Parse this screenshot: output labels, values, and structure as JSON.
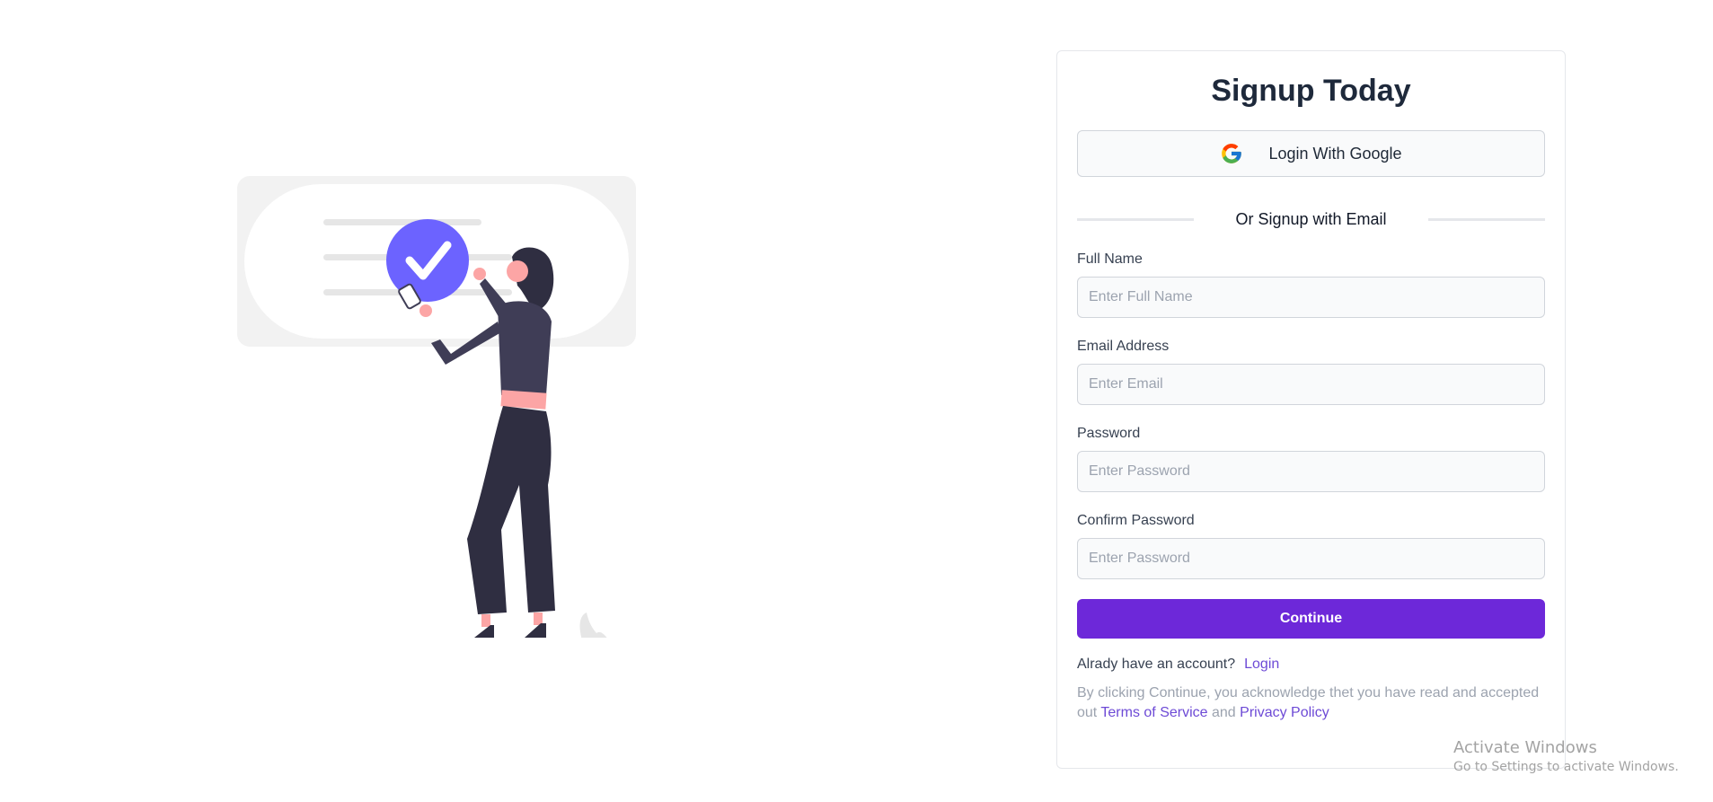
{
  "signup": {
    "title": "Signup Today",
    "google_button_label": "Login With Google",
    "divider_text": "Or Signup with Email",
    "fields": [
      {
        "label": "Full Name",
        "placeholder": "Enter Full Name",
        "value": ""
      },
      {
        "label": "Email Address",
        "placeholder": "Enter Email",
        "value": ""
      },
      {
        "label": "Password",
        "placeholder": "Enter Password",
        "value": ""
      },
      {
        "label": "Confirm Password",
        "placeholder": "Enter Password",
        "value": ""
      }
    ],
    "continue_label": "Continue",
    "login_prompt": "Alrady have an account?",
    "login_link": "Login",
    "legal_prefix": "By clicking Continue, you acknowledge thet you have read and accepted out",
    "terms_link": "Terms of Service",
    "legal_and": "and",
    "privacy_link": "Privacy Policy"
  },
  "illustration": {
    "icon": "checkmark-badge-icon",
    "accent_color": "#6c63ff"
  },
  "watermark": {
    "title": "Activate Windows",
    "subtitle": "Go to Settings to activate Windows."
  },
  "colors": {
    "primary": "#6d28d9",
    "link": "#6d4ad6",
    "title": "#1e293b"
  }
}
